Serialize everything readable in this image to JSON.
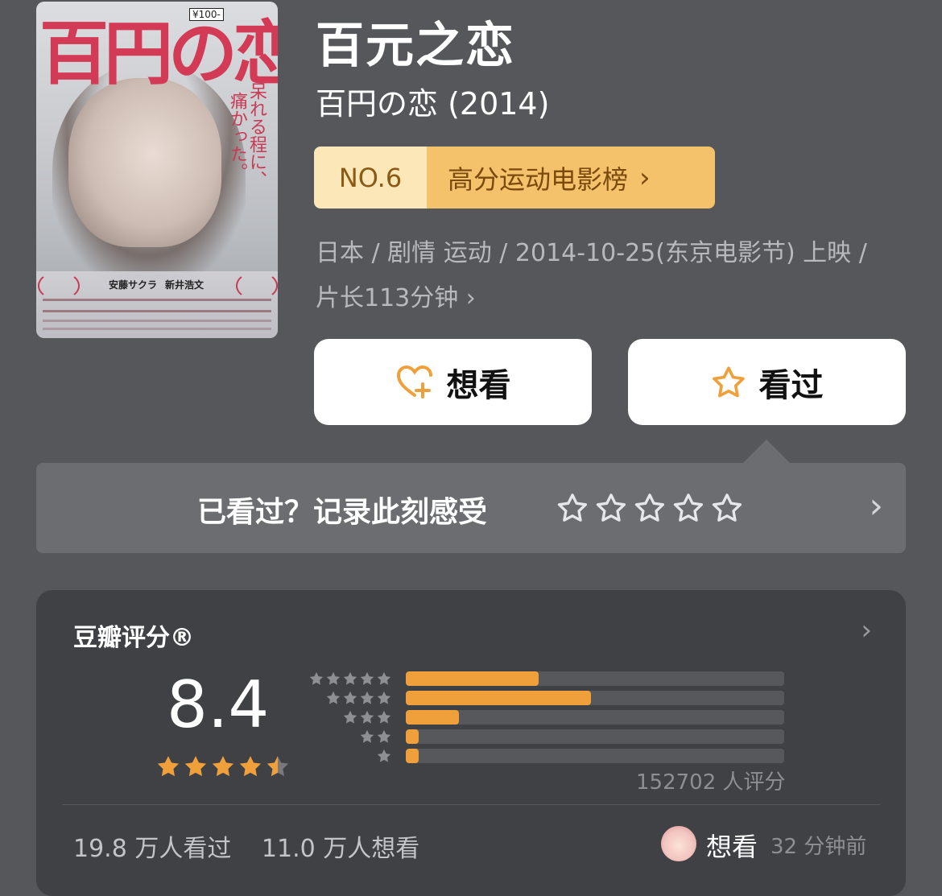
{
  "poster": {
    "title_jp": "百円の恋",
    "price": "¥100-",
    "tagline_right": "呆れる程に、",
    "tagline_left": "痛かった。",
    "cast_1": "安藤サクラ",
    "cast_2": "新井浩文"
  },
  "movie": {
    "title": "百元之恋",
    "original_title": "百円の恋 (2014)"
  },
  "ranking": {
    "number": "NO.6",
    "list_name": "高分运动电影榜",
    "chevron": "›"
  },
  "meta": "日本 / 剧情 运动 / 2014-10-25(东京电影节) 上映 / 片长113分钟 ›",
  "actions": {
    "want_label": "想看",
    "seen_label": "看过"
  },
  "record": {
    "prompt": "已看过？记录此刻感受",
    "chevron": "›"
  },
  "rating": {
    "label": "豆瓣评分®",
    "score": "8.4",
    "score_stars": 4.5,
    "distribution": [
      {
        "stars": 5,
        "value": 35
      },
      {
        "stars": 4,
        "value": 49
      },
      {
        "stars": 3,
        "value": 14
      },
      {
        "stars": 2,
        "value": 3
      },
      {
        "stars": 1,
        "value": 3
      }
    ],
    "count_text": "152702 人评分",
    "chevron": "›"
  },
  "stats": {
    "seen": "19.8 万人看过",
    "want": "11.0 万人想看"
  },
  "friend": {
    "action": "想看",
    "time": "32 分钟前"
  },
  "colors": {
    "background": "#55575b",
    "accent": "#f0a03a",
    "rank_light": "#fbe7b8",
    "rank_dark": "#f4c26a"
  }
}
